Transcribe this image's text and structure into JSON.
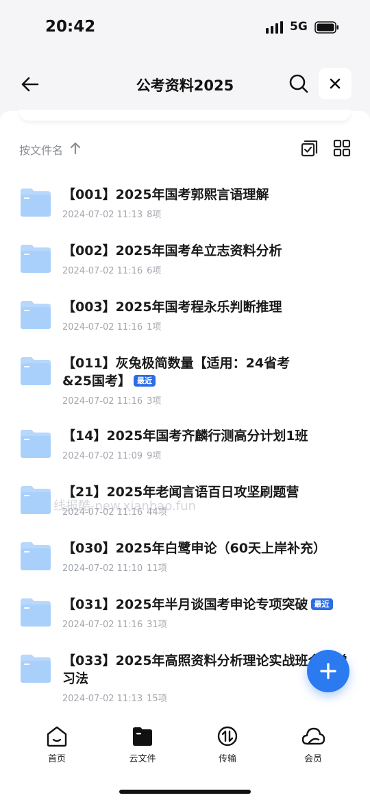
{
  "status_bar": {
    "time": "20:42",
    "network": "5G"
  },
  "nav": {
    "title": "公考资料2025"
  },
  "sort": {
    "label": "按文件名"
  },
  "files": [
    {
      "name": "【001】2025年国考郭熙言语理解",
      "date": "2024-07-02 11:13",
      "count": "8项",
      "badge": ""
    },
    {
      "name": "【002】2025年国考牟立志资料分析",
      "date": "2024-07-02 11:16",
      "count": "6项",
      "badge": ""
    },
    {
      "name": "【003】2025年国考程永乐判断推理",
      "date": "2024-07-02 11:16",
      "count": "1项",
      "badge": ""
    },
    {
      "name": "【011】灰兔极简数量【适用：24省考&25国考】",
      "date": "2024-07-02 11:16",
      "count": "3项",
      "badge": "最近"
    },
    {
      "name": "【14】2025年国考齐麟行测高分计划1班",
      "date": "2024-07-02 11:09",
      "count": "9项",
      "badge": ""
    },
    {
      "name": "【21】2025年老闻言语百日攻坚刷题营",
      "date": "2024-07-02 11:16",
      "count": "44项",
      "badge": ""
    },
    {
      "name": "【030】2025年白鹭申论（60天上岸补充）",
      "date": "2024-07-02 11:10",
      "count": "11项",
      "badge": ""
    },
    {
      "name": "【031】2025年半月谈国考申论专项突破",
      "date": "2024-07-02 11:16",
      "count": "31项",
      "badge": "最近"
    },
    {
      "name": "【033】2025年高照资料分析理论实战班全新学习法",
      "date": "2024-07-02 11:13",
      "count": "15项",
      "badge": ""
    }
  ],
  "watermark": "线报酷-new.xianbao.fun",
  "tabs": [
    {
      "label": "首页",
      "icon": "home-icon"
    },
    {
      "label": "云文件",
      "icon": "cloud-file-icon"
    },
    {
      "label": "传输",
      "icon": "transfer-icon"
    },
    {
      "label": "会员",
      "icon": "membership-cloud-icon"
    }
  ],
  "colors": {
    "accent": "#2b7af0",
    "badge": "#2b6de8",
    "folder": "#a9d0fb"
  }
}
